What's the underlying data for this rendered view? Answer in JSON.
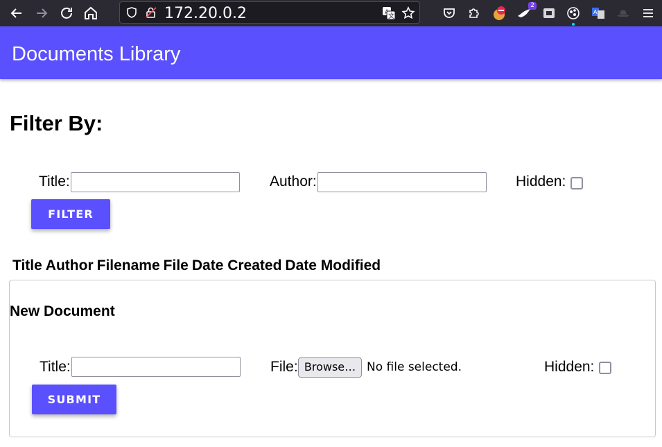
{
  "browser": {
    "url": "172.20.0.2",
    "extension_badge": "2"
  },
  "app": {
    "title": "Documents Library"
  },
  "filter": {
    "heading": "Filter By:",
    "title_label": "Title:",
    "title_value": "",
    "author_label": "Author:",
    "author_value": "",
    "hidden_label": "Hidden:",
    "hidden_checked": false,
    "button_label": "FILTER"
  },
  "table": {
    "columns": [
      "Title",
      "Author",
      "Filename",
      "File",
      "Date Created",
      "Date Modified"
    ],
    "rows": []
  },
  "new_document": {
    "heading": "New Document",
    "title_label": "Title:",
    "title_value": "",
    "file_label": "File:",
    "browse_label": "Browse…",
    "file_status": "No file selected.",
    "hidden_label": "Hidden:",
    "hidden_checked": false,
    "button_label": "SUBMIT"
  },
  "colors": {
    "accent": "#5b50fd",
    "toolbar": "#2b2a33"
  }
}
